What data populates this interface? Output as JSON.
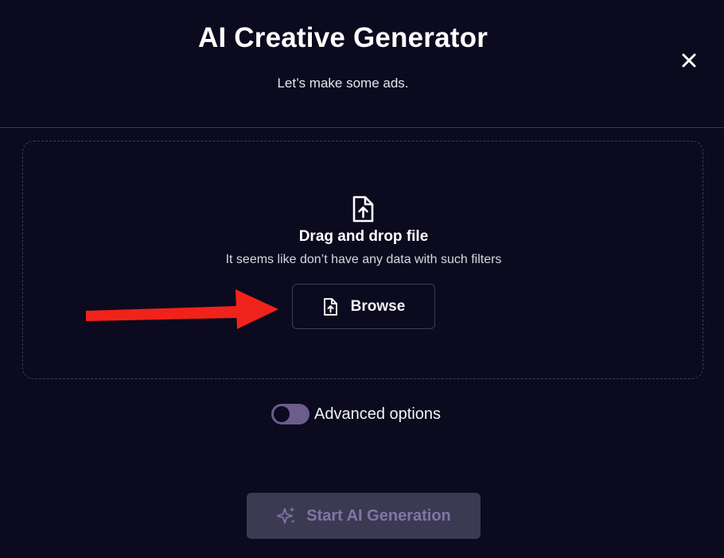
{
  "header": {
    "title": "AI Creative Generator",
    "subtitle": "Let’s make some ads.",
    "close_icon": "close-icon"
  },
  "dropzone": {
    "icon": "file-upload-icon",
    "title": "Drag and drop file",
    "description": "It seems like don’t have any data with such filters",
    "browse_label": "Browse",
    "browse_icon": "file-upload-icon"
  },
  "annotation": {
    "arrow_color": "#f0231b"
  },
  "advanced": {
    "label": "Advanced options",
    "enabled": false,
    "toggle_color": "#6c5d8c"
  },
  "footer": {
    "start_label": "Start AI Generation",
    "start_icon": "sparkles-icon",
    "start_bg": "#3c3a52",
    "start_text_color": "#7e76a8"
  },
  "theme": {
    "background": "#0b0a1e"
  }
}
